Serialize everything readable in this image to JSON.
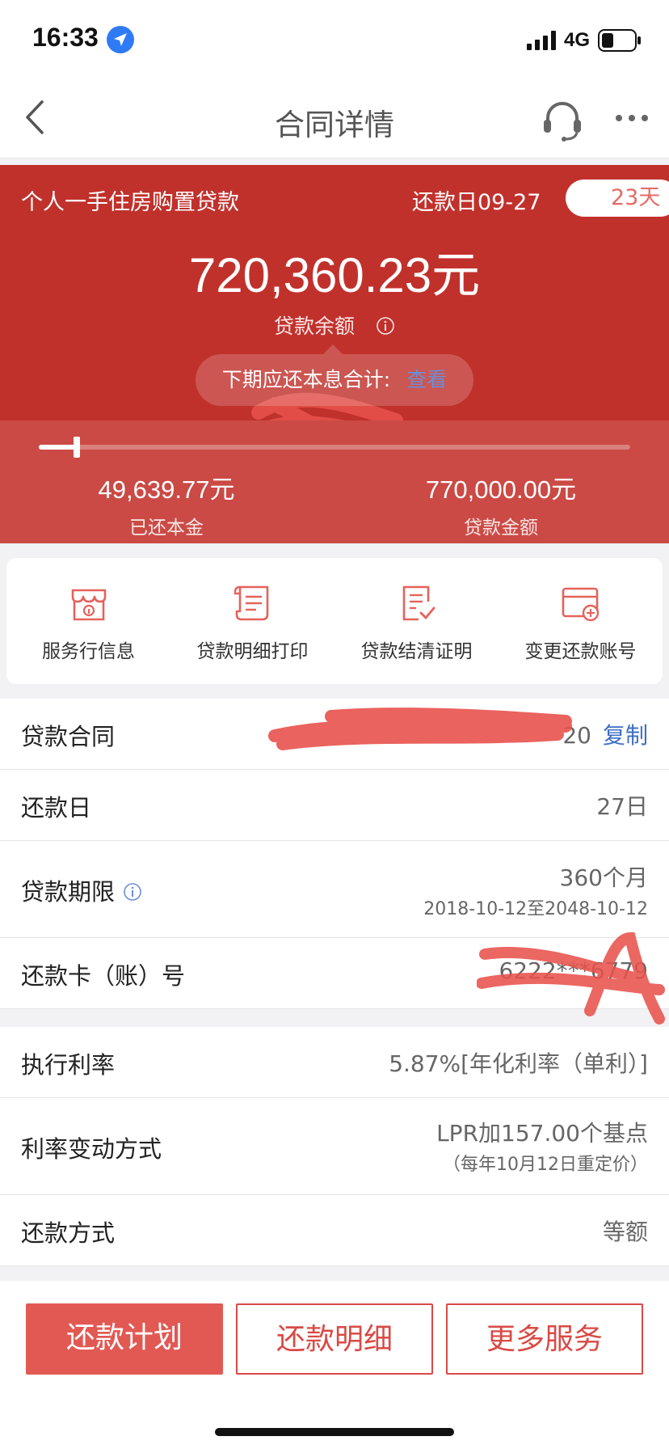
{
  "status_bar": {
    "time": "16:33",
    "network": "4G",
    "icons": [
      "location-arrow-icon",
      "signal-icon",
      "battery-icon"
    ]
  },
  "nav": {
    "title": "合同详情",
    "icons": [
      "back-icon",
      "headset-icon",
      "more-icon"
    ]
  },
  "loan_header": {
    "loan_type": "个人一手住房购置贷款",
    "repay_date": "还款日09-27",
    "days_left": "23天",
    "balance": "720,360.23元",
    "balance_label": "贷款余额",
    "next_due_label": "下期应还本息合计:",
    "view_link": "查看",
    "repaid_principal": "49,639.77元",
    "repaid_label": "已还本金",
    "loan_amount": "770,000.00元",
    "loan_amount_label": "贷款金额",
    "progress_fraction": 0.064
  },
  "services": [
    {
      "label": "服务行信息",
      "icon": "bank-info-icon"
    },
    {
      "label": "贷款明细打印",
      "icon": "print-scroll-icon"
    },
    {
      "label": "贷款结清证明",
      "icon": "certificate-check-icon"
    },
    {
      "label": "变更还款账号",
      "icon": "card-add-icon"
    }
  ],
  "details": {
    "contract_label": "贷款合同",
    "contract_value": "20",
    "copy_label": "复制",
    "repay_day_label": "还款日",
    "repay_day_value": "27日",
    "term_label": "贷款期限",
    "term_value": "360个月",
    "term_range": "2018-10-12至2048-10-12",
    "card_label": "还款卡（账）号",
    "card_value": "6222***6779",
    "rate_label": "执行利率",
    "rate_value": "5.87%[年化利率（单利）]",
    "rate_change_label": "利率变动方式",
    "rate_change_value": "LPR加157.00个基点",
    "rate_change_note": "（每年10月12日重定价）",
    "method_label": "还款方式",
    "method_value": "等额"
  },
  "actions": {
    "plan": "还款计划",
    "detail": "还款明细",
    "more": "更多服务"
  },
  "colors": {
    "header_red": "#c1312c",
    "progress_red": "#cb4a45",
    "button_red": "#e25953",
    "link_blue": "#3d6ec4"
  }
}
